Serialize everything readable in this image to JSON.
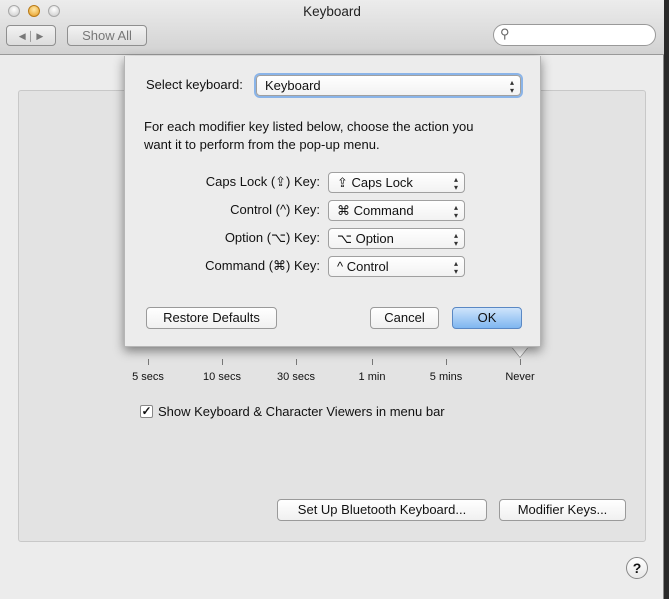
{
  "window": {
    "title": "Keyboard"
  },
  "toolbar": {
    "show_all": "Show All",
    "search_placeholder": ""
  },
  "slider": {
    "labels": [
      "5 secs",
      "10 secs",
      "30 secs",
      "1 min",
      "5 mins",
      "Never"
    ],
    "selected": "Never"
  },
  "checkbox_viewers": {
    "label": "Show Keyboard & Character Viewers in menu bar",
    "checked": true
  },
  "buttons": {
    "bluetooth": "Set Up Bluetooth Keyboard...",
    "modifier": "Modifier Keys..."
  },
  "sheet": {
    "select_label": "Select keyboard:",
    "select_value": "Keyboard",
    "instructions_1": "For each modifier key listed below, choose the action you",
    "instructions_2": "want it to perform from the pop-up menu.",
    "rows": [
      {
        "label": "Caps Lock (⇪) Key:",
        "value": "⇪ Caps Lock"
      },
      {
        "label": "Control (^) Key:",
        "value": "⌘ Command"
      },
      {
        "label": "Option (⌥) Key:",
        "value": "⌥ Option"
      },
      {
        "label": "Command (⌘) Key:",
        "value": "^ Control"
      }
    ],
    "restore": "Restore Defaults",
    "cancel": "Cancel",
    "ok": "OK"
  },
  "help": "?"
}
